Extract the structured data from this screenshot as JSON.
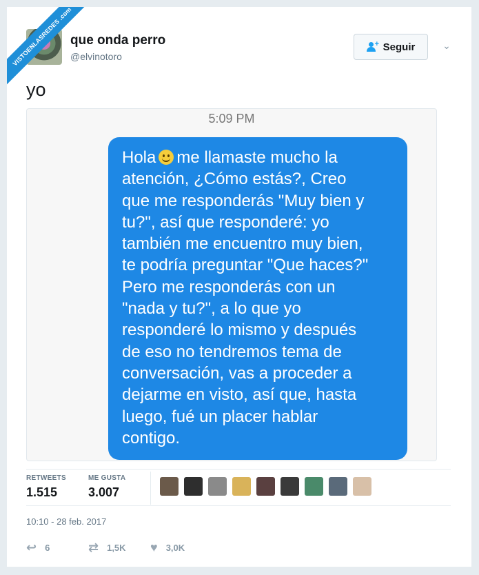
{
  "watermark": {
    "text": "VISTOENLASREDES .com"
  },
  "author": {
    "name": "que onda perro",
    "handle": "@elvinotoro",
    "avatar_icon": "profile-avatar"
  },
  "follow_button": {
    "label": "Seguir",
    "icon": "add-user-icon"
  },
  "menu": {
    "icon": "chevron-down-icon",
    "glyph": "⌄"
  },
  "tweet": {
    "text": "yo"
  },
  "media": {
    "time": "5:09 PM",
    "bubble_color": "#1e88e5",
    "message_lines": [
      "Hola",
      "me llamaste mucho la",
      "atención, ¿Cómo estás?, Creo",
      "que me responderás \"Muy bien y",
      "tu?\", así que responderé: yo",
      "también me encuentro muy bien,",
      "te podría preguntar \"Que haces?\"",
      "Pero me responderás con un",
      "\"nada y tu?\", a lo que yo",
      "responderé lo mismo y después",
      "de eso no tendremos tema de",
      "conversación, vas a proceder a",
      "dejarme en visto, así que, hasta",
      "luego, fué un placer hablar",
      "contigo."
    ]
  },
  "stats": {
    "retweets_label": "RETWEETS",
    "retweets_value": "1.515",
    "likes_label": "ME GUSTA",
    "likes_value": "3.007",
    "liker_colors": [
      "#6b5a4a",
      "#2e2e2e",
      "#8a8a8a",
      "#d9b35a",
      "#5a4040",
      "#3a3a3a",
      "#4a8a6a",
      "#5a6a7a",
      "#d8c0a8"
    ]
  },
  "timestamp": "10:10 - 28 feb. 2017",
  "actions": {
    "reply_count": "6",
    "retweet_count": "1,5K",
    "like_count": "3,0K"
  }
}
